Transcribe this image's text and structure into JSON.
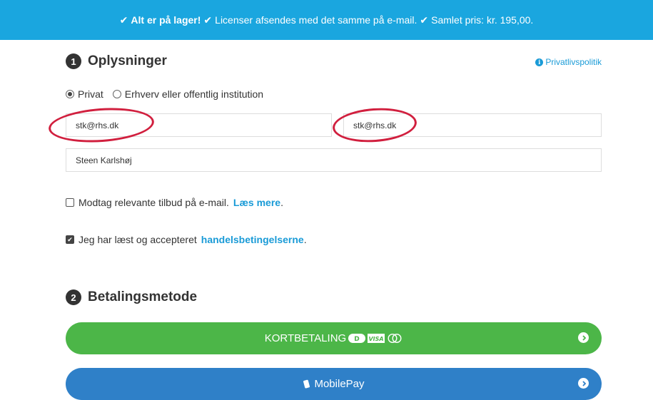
{
  "banner": {
    "check_icon": "check-icon",
    "stock_text": "Alt er på lager!",
    "license_text": "Licenser afsendes med det samme på e-mail.",
    "price_text": "Samlet pris: kr. 195,00."
  },
  "sections": {
    "info": {
      "number": "1",
      "title": "Oplysninger"
    },
    "payment": {
      "number": "2",
      "title": "Betalingsmetode"
    }
  },
  "privacy_link": {
    "icon": "info-icon",
    "label": "Privatlivspolitik"
  },
  "customer_type": {
    "options": [
      "Privat",
      "Erhverv eller offentlig institution"
    ],
    "selected": "Privat"
  },
  "fields": {
    "email": "stk@rhs.dk",
    "email_confirm": "stk@rhs.dk",
    "name": "Steen Karlshøj"
  },
  "newsletter": {
    "checked": false,
    "text": "Modtag relevante tilbud på e-mail.",
    "link": "Læs mere",
    "suffix": "."
  },
  "terms": {
    "checked": true,
    "text": "Jeg har læst og accepteret",
    "link": "handelsbetingelserne",
    "suffix": "."
  },
  "payment_methods": [
    {
      "label": "KORTBETALING",
      "icons": [
        "dankort-icon",
        "visa-icon",
        "mastercard-icon"
      ],
      "color": "#4cb648"
    },
    {
      "label": "MobilePay",
      "icons": [
        "mobilepay-icon"
      ],
      "color": "#2f80c8"
    }
  ],
  "colors": {
    "banner": "#1aa6df",
    "link": "#1a9bd7",
    "annotation": "#d11f3e"
  }
}
